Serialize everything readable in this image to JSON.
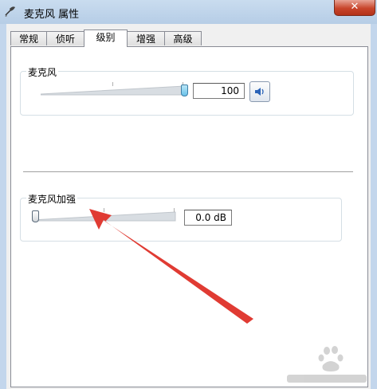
{
  "window": {
    "title": "麦克风 属性",
    "close_label": "✕"
  },
  "tabs": [
    {
      "label": "常规"
    },
    {
      "label": "侦听"
    },
    {
      "label": "级别",
      "active": true
    },
    {
      "label": "增强"
    },
    {
      "label": "高级"
    }
  ],
  "microphone": {
    "label": "麦克风",
    "value": "100",
    "level": 1.0
  },
  "boost": {
    "label": "麦克风加强",
    "value": "0.0 dB",
    "level": 0.0
  },
  "icons": {
    "title": "microphone-icon",
    "speaker": "speaker-icon"
  },
  "colors": {
    "accent_arrow": "#e03b33",
    "close_button": "#c8452b",
    "thumb_active": "#6ac2ea"
  }
}
